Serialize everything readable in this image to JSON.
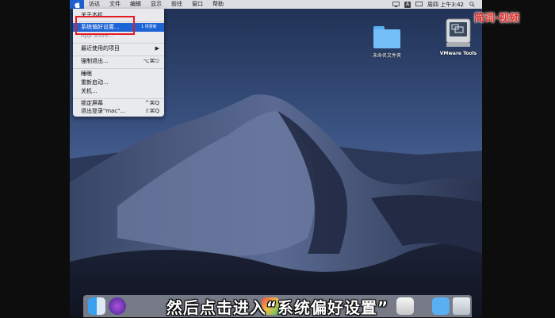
{
  "menubar": {
    "items": [
      "访达",
      "文件",
      "编辑",
      "显示",
      "前往",
      "窗口",
      "帮助"
    ],
    "clock": "周四 上午3:42",
    "input_indicator": "A"
  },
  "apple_menu": {
    "items": [
      {
        "label": "关于本机",
        "shortcut": ""
      },
      {
        "label": "系统偏好设置...",
        "shortcut": "",
        "badge": "1 项更新"
      },
      {
        "label": "App Store...",
        "shortcut": ""
      },
      {
        "label": "最近使用的项目",
        "shortcut": "▶"
      },
      {
        "label": "强制退出...",
        "shortcut": "⌥⌘⎋"
      },
      {
        "label": "睡眠",
        "shortcut": ""
      },
      {
        "label": "重新启动...",
        "shortcut": ""
      },
      {
        "label": "关机...",
        "shortcut": ""
      },
      {
        "label": "锁定屏幕",
        "shortcut": "^⌘Q"
      },
      {
        "label": "退出登录\"mac\"...",
        "shortcut": "⇧⌘Q"
      }
    ]
  },
  "desktop": {
    "folder_label": "未命名文件夹",
    "vmware_label": "VMware Tools"
  },
  "watermark": {
    "part1": "简",
    "part2": "词·视频"
  },
  "subtitle": "然后点击进入“系统偏好设置”",
  "colors": {
    "highlight": "#1c63d6",
    "annotation_box": "#e11c24"
  }
}
